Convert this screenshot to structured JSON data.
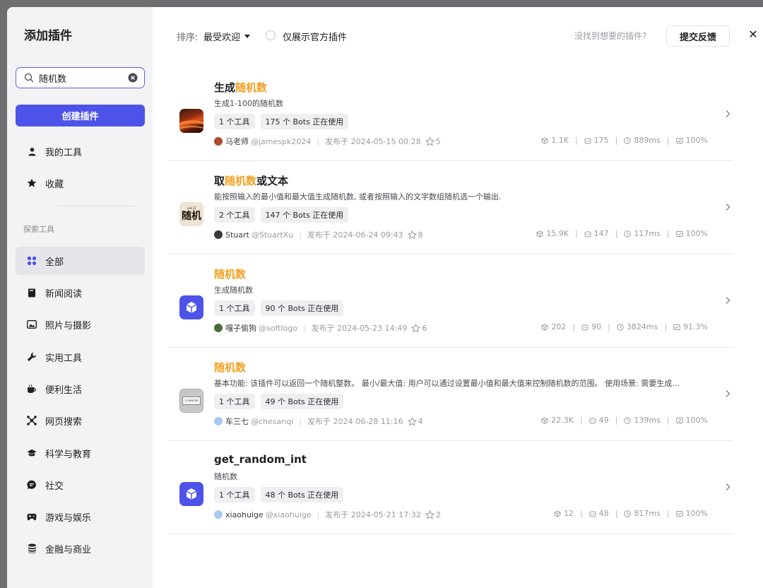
{
  "sidebar": {
    "title": "添加插件",
    "search": {
      "value": "随机数",
      "placeholder": ""
    },
    "create_label": "创建插件",
    "my_tools": "我的工具",
    "favorites": "收藏",
    "explore_label": "探索工具",
    "categories": [
      {
        "label": "全部",
        "icon": "grid-icon",
        "active": true
      },
      {
        "label": "新闻阅读",
        "icon": "book-icon"
      },
      {
        "label": "照片与摄影",
        "icon": "image-icon"
      },
      {
        "label": "实用工具",
        "icon": "wrench-icon"
      },
      {
        "label": "便利生活",
        "icon": "cup-icon"
      },
      {
        "label": "网页搜索",
        "icon": "network-icon"
      },
      {
        "label": "科学与教育",
        "icon": "graduation-cap-icon"
      },
      {
        "label": "社交",
        "icon": "chat-icon"
      },
      {
        "label": "游戏与娱乐",
        "icon": "gamepad-icon"
      },
      {
        "label": "金融与商业",
        "icon": "coins-icon"
      }
    ]
  },
  "toolbar": {
    "sort_label": "排序:",
    "sort_value": "最受欢迎",
    "official_only": "仅展示官方插件",
    "not_found": "没找到想要的插件?",
    "feedback": "提交反馈",
    "close": "✕"
  },
  "plugins": [
    {
      "title_pre": "生成",
      "title_hl": "随机数",
      "title_post": "",
      "desc": "生成1-100的随机数",
      "tools": "1 个工具",
      "bots": "175 个 Bots 正在使用",
      "author": "马老师",
      "handle": "@jamespk2024",
      "published": "发布于 2024-05-15 00:28",
      "stars": "5",
      "calls": "1.1K",
      "bots_count": "175",
      "latency": "889ms",
      "success": "100%",
      "icon": "sunset-icon"
    },
    {
      "title_pre": "取",
      "title_hl": "随机数",
      "title_post": "或文本",
      "desc": "能按照输入的最小值和最大值生成随机数, 或者按照输入的文字数组随机选一个输出.",
      "tools": "2 个工具",
      "bots": "147 个 Bots 正在使用",
      "author": "Stuart",
      "handle": "@StuartXu",
      "published": "发布于 2024-06-24 09:43",
      "stars": "8",
      "calls": "15.9K",
      "bots_count": "147",
      "latency": "117ms",
      "success": "100%",
      "icon": "suiji-text-icon",
      "icon_small": "suí  jī",
      "icon_text": "随机"
    },
    {
      "title_pre": "",
      "title_hl": "随机数",
      "title_post": "",
      "desc": "生成随机数",
      "tools": "1 个工具",
      "bots": "90 个 Bots 正在使用",
      "author": "嘎子偷狗",
      "handle": "@softlogo",
      "published": "发布于 2024-05-23 14:49",
      "stars": "6",
      "calls": "202",
      "bots_count": "90",
      "latency": "3824ms",
      "success": "91.3%",
      "icon": "cube-icon"
    },
    {
      "title_pre": "",
      "title_hl": "随机数",
      "title_post": "",
      "desc": "基本功能: 该插件可以返回一个随机整数。 最小/最大值: 用户可以通过设置最小值和最大值来控制随机数的范围。 使用场景: 需要生成…",
      "tools": "1 个工具",
      "bots": "49 个 Bots 正在使用",
      "author": "车三七",
      "handle": "@chesanqi",
      "published": "发布于 2024-06-28 11:16",
      "stars": "4",
      "calls": "22.3K",
      "bots_count": "49",
      "latency": "139ms",
      "success": "100%",
      "icon": "display-icon",
      "icon_text": "123456789"
    },
    {
      "title_pre": "get_random_int",
      "title_hl": "",
      "title_post": "",
      "desc": "随机数",
      "tools": "1 个工具",
      "bots": "48 个 Bots 正在使用",
      "author": "xiaohuige",
      "handle": "@xiaohuige",
      "published": "发布于 2024-05-21 17:32",
      "stars": "2",
      "calls": "12",
      "bots_count": "48",
      "latency": "817ms",
      "success": "100%",
      "icon": "cube-icon"
    }
  ],
  "colors": {
    "accent": "#4d53e8",
    "highlight": "#f2a020",
    "sidebar_bg": "#f3f3f5"
  }
}
